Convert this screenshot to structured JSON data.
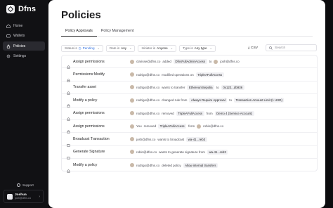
{
  "brand": {
    "name": "Dfns"
  },
  "nav": [
    {
      "label": "Home",
      "icon": "home-icon",
      "active": false
    },
    {
      "label": "Wallets",
      "icon": "wallet-icon",
      "active": false
    },
    {
      "label": "Policies",
      "icon": "policy-icon",
      "active": true
    },
    {
      "label": "Settings",
      "icon": "gear-icon",
      "active": false
    }
  ],
  "support": {
    "label": "Support"
  },
  "user": {
    "name": "Joshua",
    "email": "josh@dfns.co"
  },
  "page": {
    "title": "Policies"
  },
  "tabs": [
    {
      "label": "Policy Approvals",
      "active": true
    },
    {
      "label": "Policy Management",
      "active": false
    }
  ],
  "filters": {
    "status_label": "Status is",
    "status_value": "Pending",
    "date_label": "Date is",
    "date_value": "Any",
    "initiator_label": "Initiator is",
    "initiator_value": "Anyone",
    "type_label": "Type is",
    "type_value": "Any type",
    "csv_label": "CSV",
    "search_placeholder": "Search"
  },
  "rows": [
    {
      "title": "Assign permissions",
      "icon": "lock-icon",
      "parts": [
        {
          "k": "av"
        },
        {
          "k": "t",
          "v": "clarisse@dfns.co"
        },
        {
          "k": "t",
          "v": "added"
        },
        {
          "k": "c",
          "v": "DfnsFullAdminAccess"
        },
        {
          "k": "t",
          "v": "to"
        },
        {
          "k": "av"
        },
        {
          "k": "t",
          "v": "josh@dfns.co"
        }
      ]
    },
    {
      "title": "Permissions:Modify",
      "icon": "lock-icon",
      "parts": [
        {
          "k": "av"
        },
        {
          "k": "t",
          "v": "rodrigo@dfns.co"
        },
        {
          "k": "t",
          "v": "modified operations on"
        },
        {
          "k": "c",
          "v": "TripleAFullAccess"
        }
      ]
    },
    {
      "title": "Transfer asset",
      "icon": "lock-icon",
      "parts": [
        {
          "k": "av"
        },
        {
          "k": "t",
          "v": "rodrigo@dfns.co"
        },
        {
          "k": "t",
          "v": "wants to transfer"
        },
        {
          "k": "c",
          "v": "EthereumSepolia"
        },
        {
          "k": "t",
          "v": "to"
        },
        {
          "k": "c",
          "v": "0x122...db936"
        }
      ]
    },
    {
      "title": "Modify a policy",
      "icon": "lock-icon",
      "parts": [
        {
          "k": "av"
        },
        {
          "k": "t",
          "v": "rodrigo@dfns.co"
        },
        {
          "k": "t",
          "v": "changed rule from"
        },
        {
          "k": "c",
          "v": "Always Require Approval"
        },
        {
          "k": "t",
          "v": "to"
        },
        {
          "k": "c",
          "v": "Transaction Amount Limit (1 USD)"
        }
      ]
    },
    {
      "title": "Assign permissions",
      "icon": "lock-icon",
      "parts": [
        {
          "k": "av"
        },
        {
          "k": "t",
          "v": "rodrigo@dfns.co"
        },
        {
          "k": "t",
          "v": "removed"
        },
        {
          "k": "c",
          "v": "TripleAFullAccess"
        },
        {
          "k": "t",
          "v": "from"
        },
        {
          "k": "c",
          "v": "Demo 4 (Service Account)"
        }
      ]
    },
    {
      "title": "Assign permissions",
      "icon": "lock-icon",
      "parts": [
        {
          "k": "av"
        },
        {
          "k": "t",
          "v": "You"
        },
        {
          "k": "t",
          "v": "removed"
        },
        {
          "k": "c",
          "v": "TripleAFullAccess"
        },
        {
          "k": "t",
          "v": "from"
        },
        {
          "k": "av"
        },
        {
          "k": "t",
          "v": "robin@dfns.co"
        }
      ]
    },
    {
      "title": "Broadcast Transaction",
      "icon": "folder-icon",
      "parts": [
        {
          "k": "av"
        },
        {
          "k": "t",
          "v": "josh@dfns.co"
        },
        {
          "k": "t",
          "v": "wants to broadcast"
        },
        {
          "k": "c",
          "v": "wa-41...reb3"
        }
      ]
    },
    {
      "title": "Generate Signature",
      "icon": "folder-icon",
      "parts": [
        {
          "k": "av"
        },
        {
          "k": "t",
          "v": "robin@dfns.co"
        },
        {
          "k": "t",
          "v": "wants to generate signature from"
        },
        {
          "k": "c",
          "v": "wa-41...reb3"
        }
      ]
    },
    {
      "title": "Modify a policy",
      "icon": "lock-icon",
      "parts": [
        {
          "k": "av"
        },
        {
          "k": "t",
          "v": "rodrigo@dfns.co"
        },
        {
          "k": "t",
          "v": "deleted policy"
        },
        {
          "k": "c",
          "v": "Allow internal transfers"
        }
      ]
    }
  ]
}
